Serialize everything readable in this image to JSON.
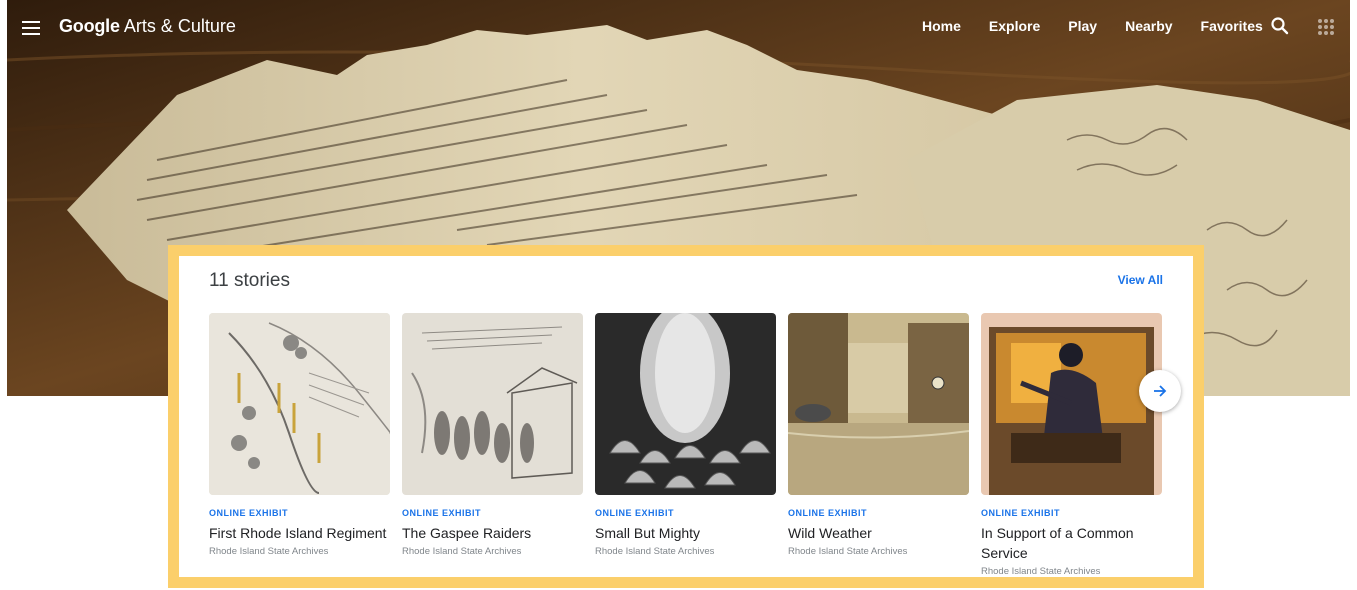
{
  "header": {
    "brand_google": "Google",
    "brand_rest": " Arts & Culture",
    "nav": [
      "Home",
      "Explore",
      "Play",
      "Nearby",
      "Favorites"
    ]
  },
  "stories": {
    "count_label": "11 stories",
    "view_all": "View All",
    "cards": [
      {
        "kind": "ONLINE EXHIBIT",
        "title": "First Rhode Island Regiment",
        "source": "Rhode Island State Archives"
      },
      {
        "kind": "ONLINE EXHIBIT",
        "title": "The Gaspee Raiders",
        "source": "Rhode Island State Archives"
      },
      {
        "kind": "ONLINE EXHIBIT",
        "title": "Small But Mighty",
        "source": "Rhode Island State Archives"
      },
      {
        "kind": "ONLINE EXHIBIT",
        "title": "Wild Weather",
        "source": "Rhode Island State Archives"
      },
      {
        "kind": "ONLINE EXHIBIT",
        "title": "In Support of a Common Service",
        "source": "Rhode Island State Archives"
      }
    ]
  },
  "icons": {
    "menu": "menu-icon",
    "search": "search-icon",
    "apps": "apps-grid-icon",
    "next": "arrow-right-icon"
  },
  "colors": {
    "accent_blue": "#1a73e8",
    "panel_border": "#fbcf6b",
    "text_dark": "#202124",
    "text_muted": "#80868b"
  }
}
